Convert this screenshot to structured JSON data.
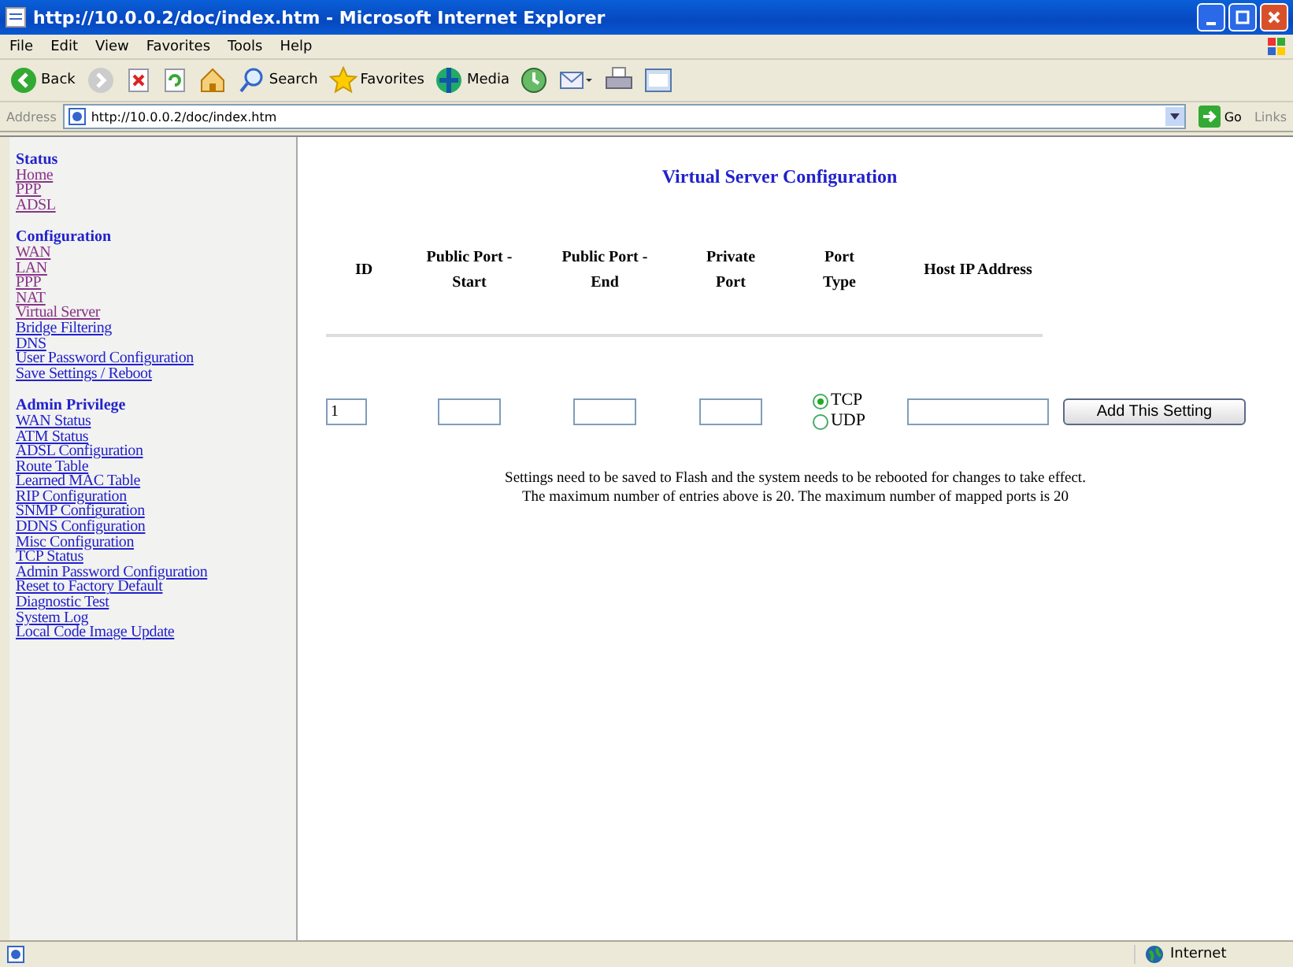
{
  "window": {
    "title": "http://10.0.0.2/doc/index.htm - Microsoft Internet Explorer"
  },
  "menu": [
    "File",
    "Edit",
    "View",
    "Favorites",
    "Tools",
    "Help"
  ],
  "toolbar": [
    {
      "kind": "back",
      "label": "Back"
    },
    {
      "kind": "forward"
    },
    {
      "kind": "stop"
    },
    {
      "kind": "refresh"
    },
    {
      "kind": "home"
    },
    {
      "kind": "search",
      "label": "Search"
    },
    {
      "kind": "favorites",
      "label": "Favorites"
    },
    {
      "kind": "media",
      "label": "Media"
    },
    {
      "kind": "history"
    },
    {
      "kind": "mail"
    },
    {
      "kind": "print"
    },
    {
      "kind": "edit"
    }
  ],
  "address_bar": {
    "label": "Address",
    "url": "http://10.0.0.2/doc/index.htm",
    "go": "Go",
    "links": "Links"
  },
  "sidebar": [
    {
      "heading": "Status",
      "items": [
        {
          "label": "Home",
          "visited": true
        },
        {
          "label": "PPP",
          "visited": true
        },
        {
          "label": "ADSL",
          "visited": true
        }
      ]
    },
    {
      "heading": "Configuration",
      "items": [
        {
          "label": "WAN",
          "visited": true
        },
        {
          "label": "LAN",
          "visited": true
        },
        {
          "label": "PPP",
          "visited": true
        },
        {
          "label": "NAT",
          "visited": true
        },
        {
          "label": "Virtual Server",
          "visited": true
        },
        {
          "label": "Bridge Filtering",
          "visited": false
        },
        {
          "label": "DNS",
          "visited": false
        },
        {
          "label": "User Password Configuration",
          "visited": false
        },
        {
          "label": "Save Settings / Reboot",
          "visited": false
        }
      ]
    },
    {
      "heading": "Admin Privilege",
      "items": [
        {
          "label": "WAN Status",
          "visited": false
        },
        {
          "label": "ATM Status",
          "visited": false
        },
        {
          "label": "ADSL Configuration",
          "visited": false
        },
        {
          "label": "Route Table",
          "visited": false
        },
        {
          "label": "Learned MAC Table",
          "visited": false
        },
        {
          "label": "RIP Configuration",
          "visited": false
        },
        {
          "label": "SNMP Configuration",
          "visited": false
        },
        {
          "label": "DDNS Configuration",
          "visited": false
        },
        {
          "label": "Misc Configuration",
          "visited": false
        },
        {
          "label": "TCP Status",
          "visited": false
        },
        {
          "label": "Admin Password Configuration",
          "visited": false
        },
        {
          "label": "Reset to Factory Default",
          "visited": false
        },
        {
          "label": "Diagnostic Test",
          "visited": false
        },
        {
          "label": "System Log",
          "visited": false
        },
        {
          "label": "Local Code Image Update",
          "visited": false
        }
      ]
    }
  ],
  "page": {
    "title": "Virtual Server Configuration",
    "columns": [
      [
        "ID"
      ],
      [
        "Public Port -",
        "Start"
      ],
      [
        "Public Port -",
        "End"
      ],
      [
        "Private",
        "Port"
      ],
      [
        "Port",
        "Type"
      ],
      [
        "Host IP Address"
      ]
    ],
    "id_value": "1",
    "port_types": [
      {
        "label": "TCP",
        "selected": true
      },
      {
        "label": "UDP",
        "selected": false
      }
    ],
    "add_button": "Add This Setting",
    "notes": [
      "Settings need to be saved to Flash and the system needs to be rebooted for changes to take effect.",
      "The maximum number of entries above is  20. The maximum number of mapped ports is  20"
    ]
  },
  "status_bar": {
    "zone": "Internet"
  }
}
